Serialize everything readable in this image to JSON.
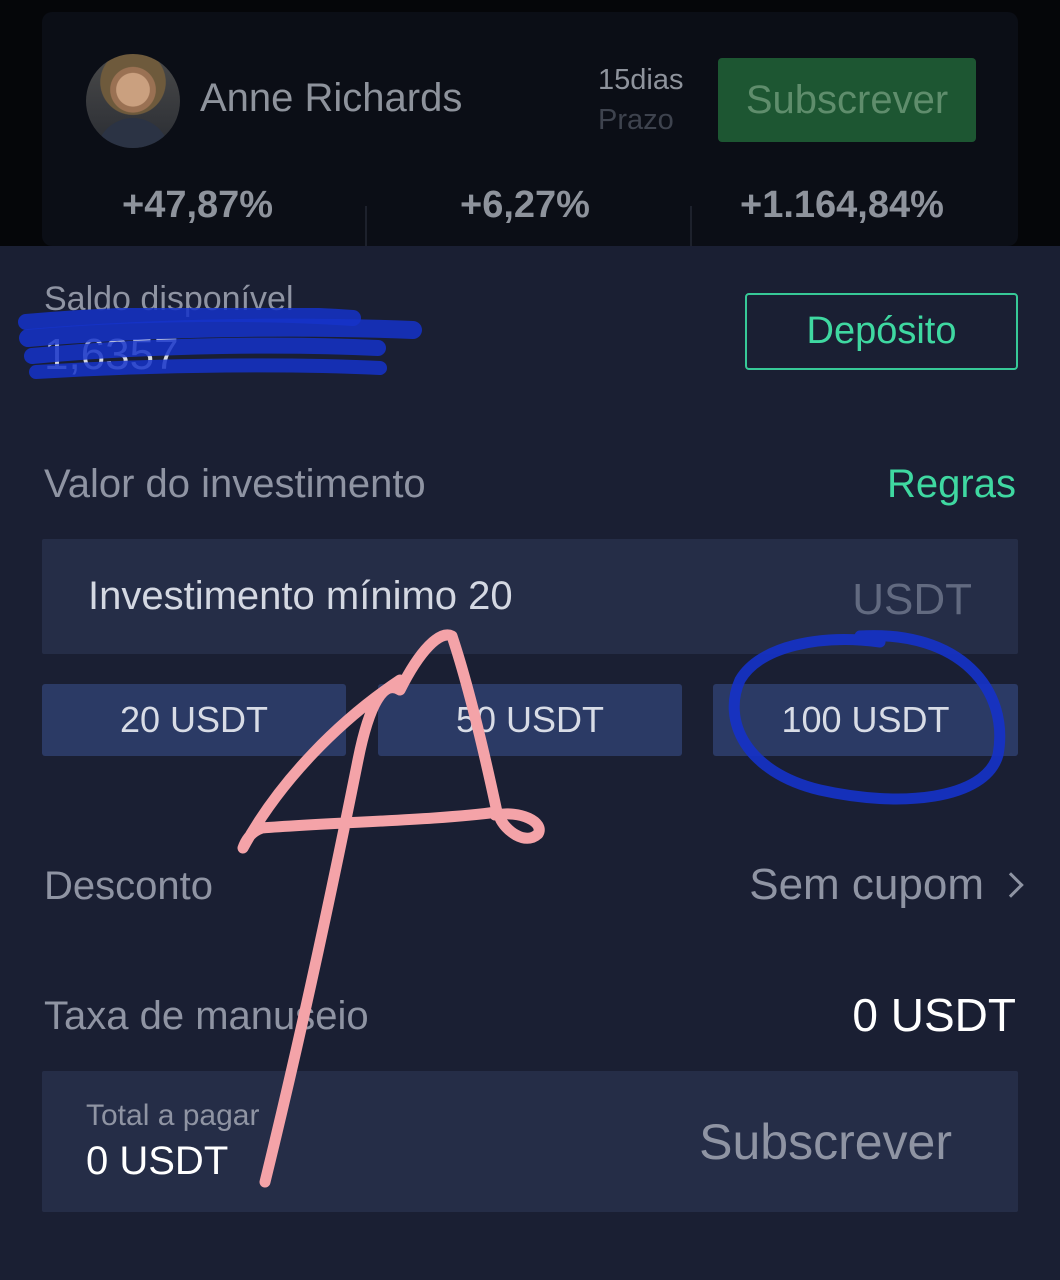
{
  "trader": {
    "name": "Anne Richards",
    "term_value": "15dias",
    "term_label": "Prazo",
    "subscribe_label": "Subscrever",
    "stats": [
      "+47,87%",
      "+6,27%",
      "+1.164,84%"
    ]
  },
  "balance": {
    "label": "Saldo disponível",
    "value": "1,6357",
    "deposit_label": "Depósito"
  },
  "investment": {
    "label": "Valor do investimento",
    "rules_label": "Regras",
    "input_placeholder": "Investimento mínimo 20",
    "unit": "USDT",
    "quick_amounts": [
      "20 USDT",
      "50 USDT",
      "100 USDT"
    ]
  },
  "discount": {
    "label": "Desconto",
    "value": "Sem cupom"
  },
  "fee": {
    "label": "Taxa de manuseio",
    "value": "0 USDT"
  },
  "payment": {
    "total_label": "Total a pagar",
    "total_value": "0 USDT",
    "subscribe_label": "Subscrever"
  },
  "colors": {
    "accent": "#3fd8a1",
    "background": "#1a1f33",
    "input_bg": "#252d47",
    "quick_btn_bg": "#2b3a65",
    "annotation_pink": "#f4a3a8",
    "annotation_blue": "#1532c9"
  }
}
